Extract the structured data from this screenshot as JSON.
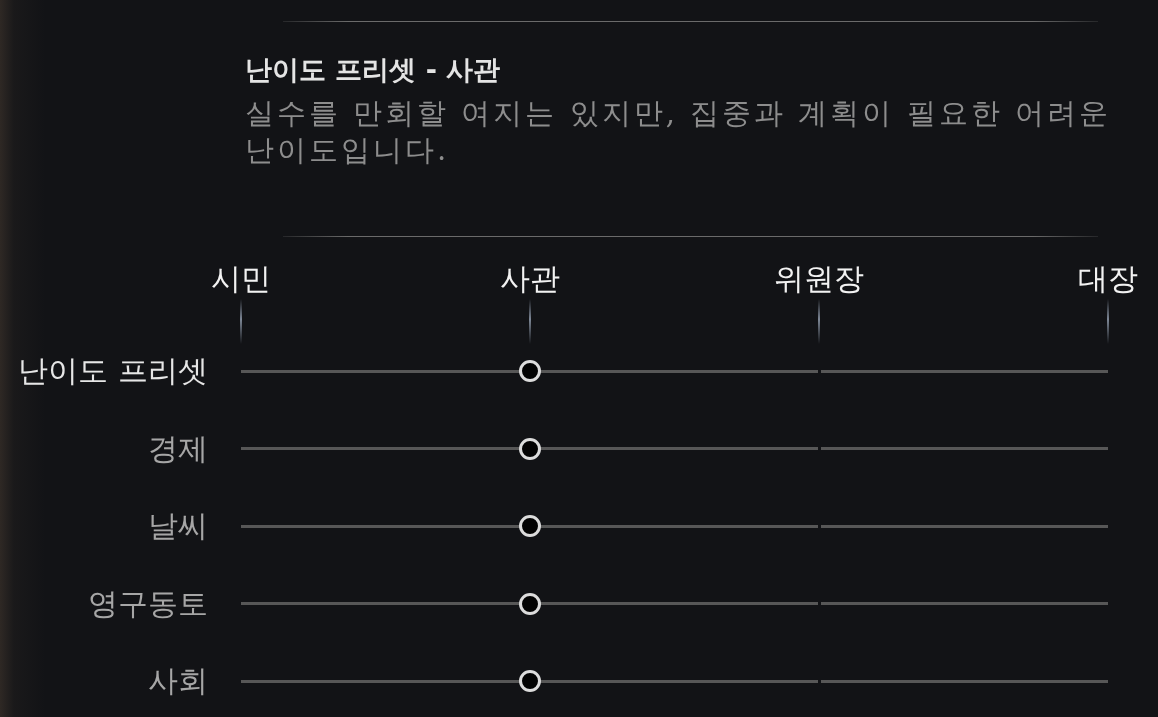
{
  "preset_info": {
    "title": "난이도 프리셋 - 사관",
    "description": "실수를 만회할 여지는 있지만, 집중과 계획이 필요한 어려운 난이도입니다."
  },
  "scale": {
    "stops": [
      "시민",
      "사관",
      "위원장",
      "대장"
    ]
  },
  "sliders": [
    {
      "label": "난이도 프리셋",
      "selected": true,
      "level": 0.333
    },
    {
      "label": "경제",
      "selected": false,
      "level": 0.333
    },
    {
      "label": "날씨",
      "selected": false,
      "level": 0.333
    },
    {
      "label": "영구동토",
      "selected": false,
      "level": 0.333
    },
    {
      "label": "사회",
      "selected": false,
      "level": 0.333
    }
  ]
}
